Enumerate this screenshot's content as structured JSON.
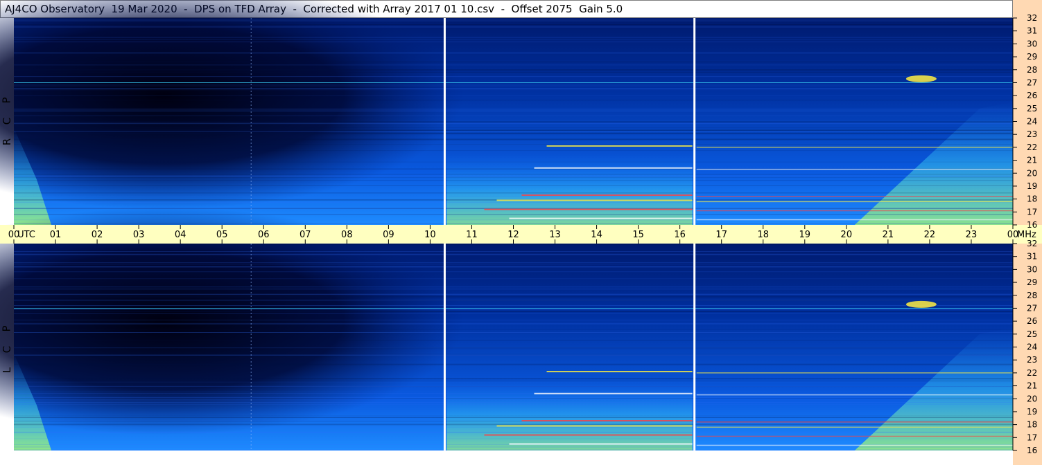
{
  "title": "AJ4CO Observatory  19 Mar 2020  -  DPS on TFD Array  -  Corrected with Array 2017 01 10.csv  -  Offset 2075  Gain 5.0",
  "panels": [
    {
      "id": "rcp",
      "label_letters": [
        "P",
        "C",
        "R"
      ]
    },
    {
      "id": "lcp",
      "label_letters": [
        "P",
        "C",
        "L"
      ]
    }
  ],
  "chart_data": {
    "type": "heatmap",
    "title": "AJ4CO Observatory  19 Mar 2020  -  DPS on TFD Array  -  Corrected with Array 2017 01 10.csv  -  Offset 2075  Gain 5.0",
    "x_axis": {
      "unit_label": "UTC",
      "ticks": [
        "00",
        "01",
        "02",
        "03",
        "04",
        "05",
        "06",
        "07",
        "08",
        "09",
        "10",
        "11",
        "12",
        "13",
        "14",
        "15",
        "16",
        "17",
        "18",
        "19",
        "20",
        "21",
        "22",
        "23",
        "00"
      ],
      "range": [
        0,
        24
      ]
    },
    "y_axis": {
      "unit_label": "MHz",
      "ticks": [
        "32",
        "31",
        "30",
        "29",
        "28",
        "27",
        "26",
        "25",
        "24",
        "23",
        "22",
        "21",
        "20",
        "19",
        "18",
        "17",
        "16"
      ],
      "range": [
        16,
        32
      ]
    },
    "series": [
      {
        "name": "RCP",
        "polarization": "R C P"
      },
      {
        "name": "LCP",
        "polarization": "L C P"
      }
    ],
    "colormap": [
      "#000010",
      "#001a6e",
      "#0040c8",
      "#1e8cff",
      "#38c8f0",
      "#9ef07a",
      "#ffef40",
      "#ff4040",
      "#ffffff"
    ],
    "gaps_utc": [
      10.35,
      16.35
    ],
    "grid": false
  },
  "colors": {
    "axis_band": "#ffffc0",
    "right_axis_bg": "#ffd9b3",
    "gap_line": "#ffffff",
    "deep_night": "#000010",
    "sky_blue": "#0040c8",
    "hot": "#ffef40"
  }
}
